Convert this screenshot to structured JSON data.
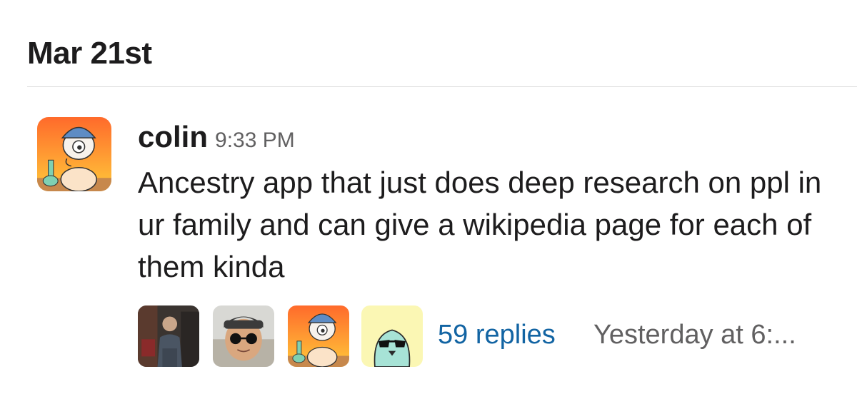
{
  "date_header": "Mar 21st",
  "message": {
    "username": "colin",
    "timestamp": "9:33 PM",
    "text": "Ancestry app that just does deep research on ppl in ur family and can give a wikipedia page for each of them kinda",
    "avatar_icon": "cartoon-character-icon"
  },
  "thread": {
    "participants": [
      {
        "avatar_icon": "person-photo-icon"
      },
      {
        "avatar_icon": "person-sunglasses-photo-icon"
      },
      {
        "avatar_icon": "cartoon-character-icon"
      },
      {
        "avatar_icon": "penguin-sunglasses-icon"
      }
    ],
    "replies_label": "59 replies",
    "last_reply": "Yesterday at 6:..."
  },
  "colors": {
    "link": "#1264a3",
    "muted": "#616061",
    "text": "#1d1c1d"
  }
}
